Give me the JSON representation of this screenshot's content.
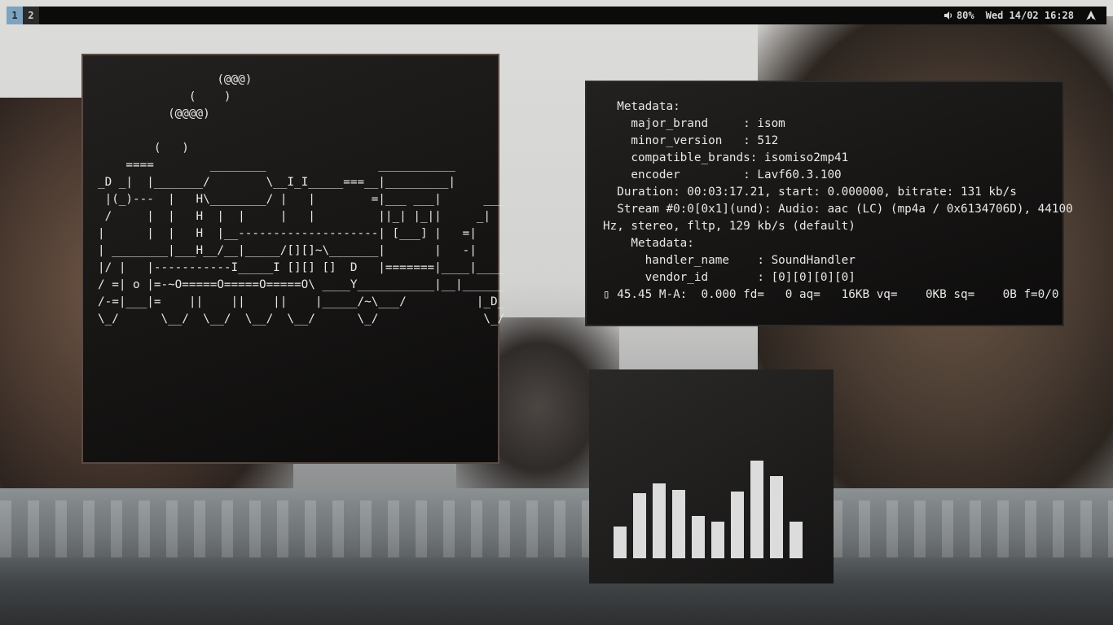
{
  "topbar": {
    "workspaces": [
      {
        "label": "1",
        "active": true
      },
      {
        "label": "2",
        "active": false
      }
    ],
    "volume": "80%",
    "datetime": "Wed 14/02 16:28",
    "icons": [
      "volume-icon",
      "arch-logo-icon"
    ],
    "accent_color": "#7ea3bf"
  },
  "ascii_window": {
    "lines": [
      "                 (@@@)",
      "             (    )",
      "          (@@@@)",
      "",
      "        (   )",
      "    ====        ________                ___________",
      "_D _|  |_______/        \\__I_I_____===__|_________|",
      " |(_)---  |   H\\________/ |   |        =|___ ___|      ___",
      " /     |  |   H  |  |     |   |         ||_| |_||     _|",
      "|      |  |   H  |__--------------------| [___] |   =|",
      "| ________|___H__/__|_____/[][]~\\_______|       |   -|",
      "|/ |   |-----------I_____I [][] []  D   |=======|____|____",
      "/ =| o |=-~O=====O=====O=====O\\ ____Y___________|__|______",
      "/-=|___|=    ||    ||    ||    |_____/~\\___/          |_D_",
      "\\_/      \\__/  \\__/  \\__/  \\__/      \\_/               \\_/"
    ]
  },
  "ffplay_window": {
    "lines": [
      "  Metadata:",
      "    major_brand     : isom",
      "    minor_version   : 512",
      "    compatible_brands: isomiso2mp41",
      "    encoder         : Lavf60.3.100",
      "  Duration: 00:03:17.21, start: 0.000000, bitrate: 131 kb/s",
      "  Stream #0:0[0x1](und): Audio: aac (LC) (mp4a / 0x6134706D), 44100",
      "Hz, stereo, fltp, 129 kb/s (default)",
      "    Metadata:",
      "      handler_name    : SoundHandler",
      "      vendor_id       : [0][0][0][0]",
      "  45.45 M-A:  0.000 fd=   0 aq=   16KB vq=    0KB sq=    0B f=0/0"
    ],
    "cursor": "▯"
  },
  "visualizer": {
    "levels": [
      0.18,
      0.37,
      0.43,
      0.39,
      0.24,
      0.21,
      0.38,
      0.56,
      0.47,
      0.21
    ],
    "bar_color": "#dcdcdc"
  }
}
